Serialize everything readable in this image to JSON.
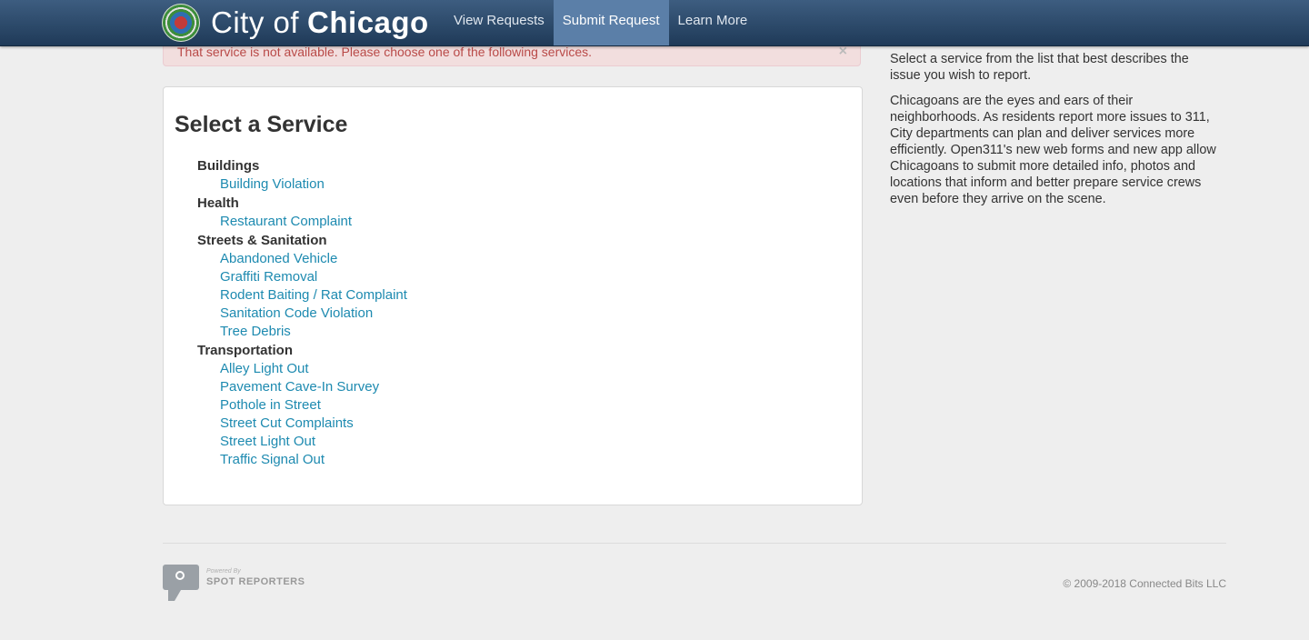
{
  "header": {
    "brand_light": "City of",
    "brand_bold": "Chicago",
    "nav": [
      {
        "label": "View Requests",
        "active": false
      },
      {
        "label": "Submit Request",
        "active": true
      },
      {
        "label": "Learn More",
        "active": false
      }
    ]
  },
  "alert": {
    "message": "That service is not available. Please choose one of the following services.",
    "close": "×"
  },
  "main": {
    "title": "Select a Service",
    "groups": [
      {
        "name": "Buildings",
        "services": [
          "Building Violation"
        ]
      },
      {
        "name": "Health",
        "services": [
          "Restaurant Complaint"
        ]
      },
      {
        "name": "Streets & Sanitation",
        "services": [
          "Abandoned Vehicle",
          "Graffiti Removal",
          "Rodent Baiting / Rat Complaint",
          "Sanitation Code Violation",
          "Tree Debris"
        ]
      },
      {
        "name": "Transportation",
        "services": [
          "Alley Light Out",
          "Pavement Cave-In Survey",
          "Pothole in Street",
          "Street Cut Complaints",
          "Street Light Out",
          "Traffic Signal Out"
        ]
      }
    ]
  },
  "sidebar": {
    "intro": "Select a service from the list that best describes the issue you wish to report.",
    "body": "Chicagoans are the eyes and ears of their neighborhoods. As residents report more issues to 311, City departments can plan and deliver services more efficiently. Open311's new web forms and new app allow Chicagoans to submit more detailed info, photos and locations that inform and better prepare service crews even before they arrive on the scene."
  },
  "footer": {
    "powered_by": "Powered By",
    "spot_reporters": "SPOT REPORTERS",
    "copyright": "© 2009-2018 Connected Bits LLC"
  },
  "colors": {
    "link": "#1d8ab0",
    "nav_bg": "#2b4a6b",
    "nav_active": "#5b7fa8",
    "alert_text": "#b94a48",
    "alert_bg": "#f2dede"
  }
}
